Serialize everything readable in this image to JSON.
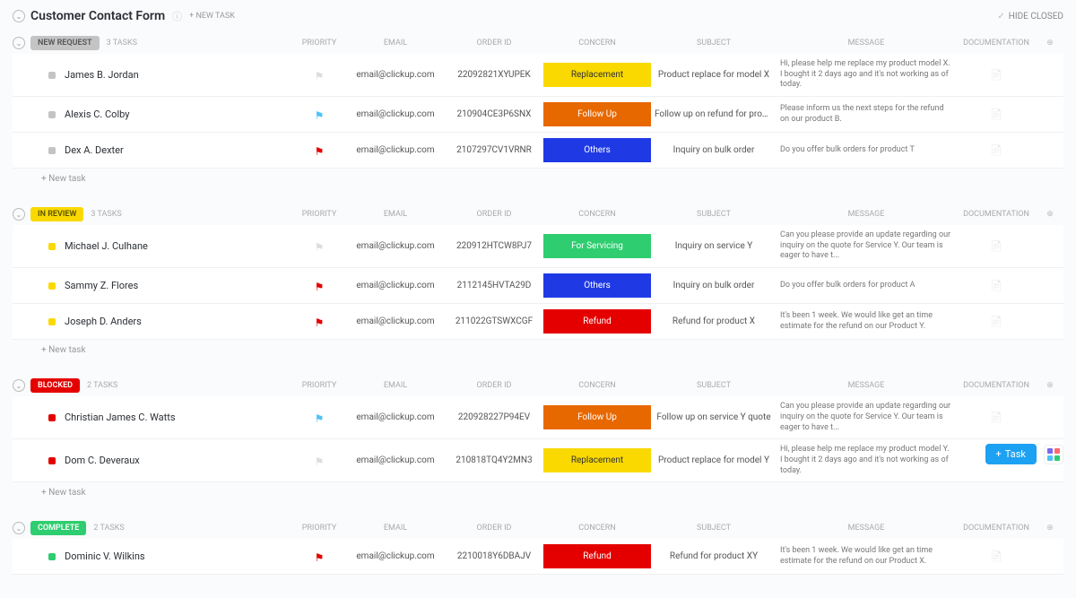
{
  "header": {
    "title": "Customer Contact Form",
    "new_task": "+ NEW TASK",
    "hide_closed": "HIDE CLOSED"
  },
  "columns": {
    "priority": "PRIORITY",
    "email": "EMAIL",
    "order_id": "ORDER ID",
    "concern": "CONCERN",
    "subject": "SUBJECT",
    "message": "MESSAGE",
    "documentation": "DOCUMENTATION"
  },
  "new_task_row": "+ New task",
  "fab": {
    "task": "Task"
  },
  "groups": [
    {
      "status": "NEW REQUEST",
      "color": "grey",
      "count": "3 TASKS",
      "tasks": [
        {
          "name": "James B. Jordan",
          "priority": "none",
          "email": "email@clickup.com",
          "order": "22092821XYUPEK",
          "concern": "Replacement",
          "concern_cls": "replacement",
          "subject": "Product replace for model X",
          "message": "Hi, please help me replace my product model X. I bought it 2 days ago and it's not working as of today."
        },
        {
          "name": "Alexis C. Colby",
          "priority": "blue",
          "email": "email@clickup.com",
          "order": "210904CE3P6SNX",
          "concern": "Follow Up",
          "concern_cls": "followup",
          "subject": "Follow up on refund for produ...",
          "message": "Please inform us the next steps for the refund on our product B."
        },
        {
          "name": "Dex A. Dexter",
          "priority": "redf",
          "email": "email@clickup.com",
          "order": "2107297CV1VRNR",
          "concern": "Others",
          "concern_cls": "others",
          "subject": "Inquiry on bulk order",
          "message": "Do you offer bulk orders for product T"
        }
      ]
    },
    {
      "status": "IN REVIEW",
      "color": "yellow",
      "count": "3 TASKS",
      "tasks": [
        {
          "name": "Michael J. Culhane",
          "priority": "none",
          "email": "email@clickup.com",
          "order": "220912HTCW8PJ7",
          "concern": "For Servicing",
          "concern_cls": "servicing",
          "subject": "Inquiry on service Y",
          "message": "Can you please provide an update regarding our inquiry on the quote for Service Y. Our team is eager to have t..."
        },
        {
          "name": "Sammy Z. Flores",
          "priority": "redf",
          "email": "email@clickup.com",
          "order": "2112145HVTA29D",
          "concern": "Others",
          "concern_cls": "others",
          "subject": "Inquiry on bulk order",
          "message": "Do you offer bulk orders for product A"
        },
        {
          "name": "Joseph D. Anders",
          "priority": "redf",
          "email": "email@clickup.com",
          "order": "211022GTSWXCGF",
          "concern": "Refund",
          "concern_cls": "refund",
          "subject": "Refund for product X",
          "message": "It's been 1 week. We would like get an time estimate for the refund on our Product Y."
        }
      ]
    },
    {
      "status": "BLOCKED",
      "color": "red",
      "count": "2 TASKS",
      "tasks": [
        {
          "name": "Christian James C. Watts",
          "priority": "blue",
          "email": "email@clickup.com",
          "order": "220928227P94EV",
          "concern": "Follow Up",
          "concern_cls": "followup",
          "subject": "Follow up on service Y quote",
          "message": "Can you please provide an update regarding our inquiry on the quote for Service Y. Our team is eager to have t..."
        },
        {
          "name": "Dom C. Deveraux",
          "priority": "none",
          "email": "email@clickup.com",
          "order": "210818TQ4Y2MN3",
          "concern": "Replacement",
          "concern_cls": "replacement",
          "subject": "Product replace for model Y",
          "message": "Hi, please help me replace my product model Y. I bought it 2 days ago and it's not working as of today."
        }
      ]
    },
    {
      "status": "COMPLETE",
      "color": "green",
      "count": "2 TASKS",
      "tasks": [
        {
          "name": "Dominic V. Wilkins",
          "priority": "redf",
          "email": "email@clickup.com",
          "order": "2210018Y6DBAJV",
          "concern": "Refund",
          "concern_cls": "refund",
          "subject": "Refund for product XY",
          "message": "It's been 1 week. We would like get an time estimate for the refund on our Product X."
        }
      ]
    }
  ]
}
